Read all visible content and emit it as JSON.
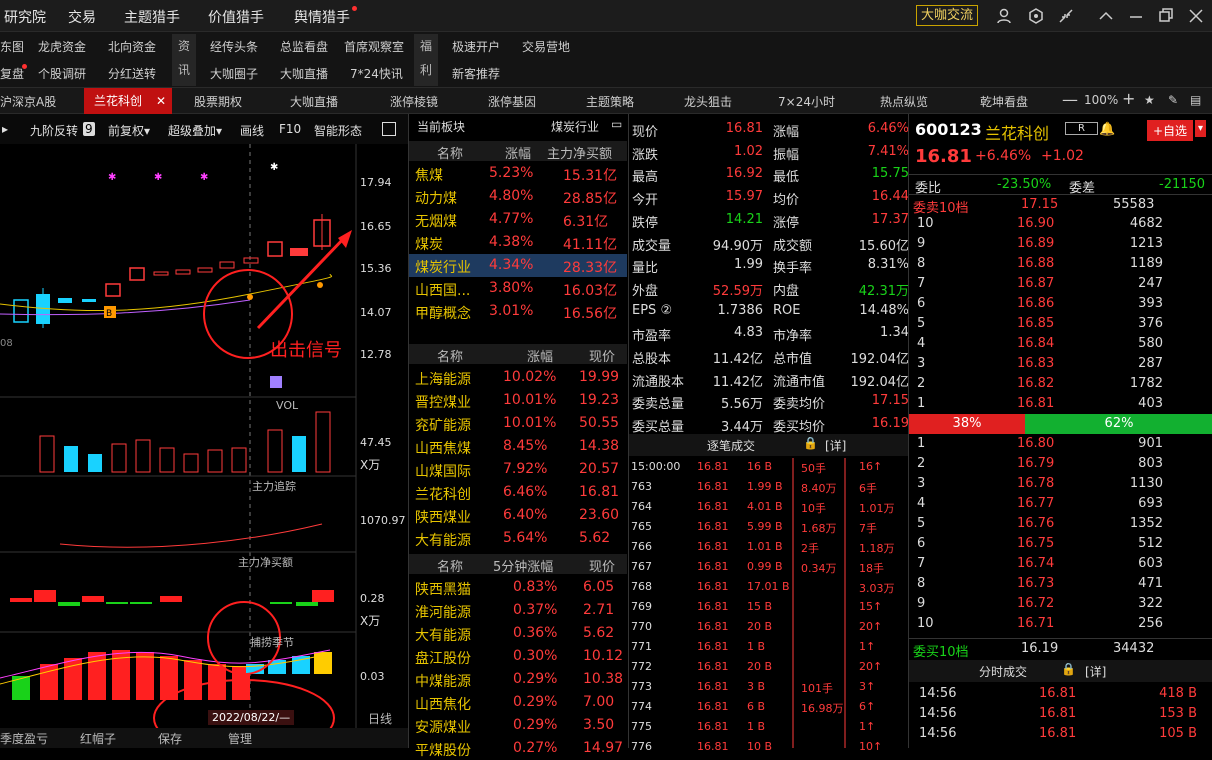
{
  "topnav": [
    "研究院",
    "交易",
    "主题猎手",
    "价值猎手",
    "舆情猎手"
  ],
  "promo": "大咖交流",
  "bar2": {
    "left1": [
      "东图",
      "龙虎资金",
      "北向资金"
    ],
    "left2": [
      "复盘",
      "个股调研",
      "分红送转"
    ],
    "v1": [
      "资",
      "讯"
    ],
    "mid1": [
      "经传头条",
      "总监看盘",
      "首席观察室"
    ],
    "mid2": [
      "大咖圈子",
      "大咖直播",
      "7*24快讯"
    ],
    "v2": [
      "福",
      "利"
    ],
    "r1": [
      "极速开户",
      "交易营地"
    ],
    "r2": [
      "新客推荐"
    ]
  },
  "tabs": [
    "沪深京A股",
    "兰花科创",
    "股票期权",
    "大咖直播",
    "涨停棱镜",
    "涨停基因",
    "主题策略",
    "龙头狙击",
    "7×24小时",
    "热点纵览",
    "乾坤看盘"
  ],
  "zoom": "100%",
  "chart_tools": [
    "九阶反转",
    "9",
    "前复权▾",
    "超级叠加▾",
    "画线",
    "F10",
    "智能形态"
  ],
  "chart": {
    "ylabels": [
      "17.94",
      "16.65",
      "15.36",
      "14.07",
      "12.78"
    ],
    "signal": "出击信号",
    "vol": "VOL",
    "vol_labels": [
      "47.45",
      "X万"
    ],
    "track": "主力追踪",
    "track_label": "1070.97",
    "net": "主力净买额",
    "net_labels": [
      "0.28",
      "X万"
    ],
    "season": "捕捞季节",
    "season_label": "0.03",
    "date": "2022/08/22/—",
    "lower_right": "日线",
    "bottom_tabs": [
      "季度盈亏",
      "红帽子",
      "保存",
      "管理"
    ],
    "b_label": "B",
    "left_tick": "08"
  },
  "sector": {
    "header": [
      "当前板块",
      "煤炭行业"
    ],
    "cols": [
      "名称",
      "涨幅",
      "主力净买额"
    ],
    "rows": [
      [
        "焦煤",
        "5.23%",
        "15.31亿"
      ],
      [
        "动力煤",
        "4.80%",
        "28.85亿"
      ],
      [
        "无烟煤",
        "4.77%",
        "6.31亿"
      ],
      [
        "煤炭",
        "4.38%",
        "41.11亿"
      ],
      [
        "煤炭行业",
        "4.34%",
        "28.33亿"
      ],
      [
        "山西国...",
        "3.80%",
        "16.03亿"
      ],
      [
        "甲醇概念",
        "3.01%",
        "16.56亿"
      ]
    ],
    "cols2": [
      "名称",
      "涨幅",
      "现价"
    ],
    "stocks": [
      [
        "上海能源",
        "10.02%",
        "19.99"
      ],
      [
        "晋控煤业",
        "10.01%",
        "19.23"
      ],
      [
        "兖矿能源",
        "10.01%",
        "50.55"
      ],
      [
        "山西焦煤",
        "8.45%",
        "14.38"
      ],
      [
        "山煤国际",
        "7.92%",
        "20.57"
      ],
      [
        "兰花科创",
        "6.46%",
        "16.81"
      ],
      [
        "陕西煤业",
        "6.40%",
        "23.60"
      ],
      [
        "大有能源",
        "5.64%",
        "5.62"
      ]
    ],
    "cols3": [
      "名称",
      "5分钟涨幅",
      "现价"
    ],
    "fast": [
      [
        "陕西黑猫",
        "0.83%",
        "6.05"
      ],
      [
        "淮河能源",
        "0.37%",
        "2.71"
      ],
      [
        "大有能源",
        "0.36%",
        "5.62"
      ],
      [
        "盘江股份",
        "0.30%",
        "10.12"
      ],
      [
        "中煤能源",
        "0.29%",
        "10.38"
      ],
      [
        "山西焦化",
        "0.29%",
        "7.00"
      ],
      [
        "安源煤业",
        "0.29%",
        "3.50"
      ],
      [
        "平煤股份",
        "0.27%",
        "14.97"
      ]
    ]
  },
  "quote": [
    [
      "现价",
      "16.81",
      "涨幅",
      "6.46%"
    ],
    [
      "涨跌",
      "1.02",
      "振幅",
      "7.41%"
    ],
    [
      "最高",
      "16.92",
      "最低",
      "15.75"
    ],
    [
      "今开",
      "15.97",
      "均价",
      "16.44"
    ],
    [
      "跌停",
      "14.21",
      "涨停",
      "17.37"
    ],
    [
      "成交量",
      "94.90万",
      "成交额",
      "15.60亿"
    ],
    [
      "量比",
      "1.99",
      "换手率",
      "8.31%"
    ],
    [
      "外盘",
      "52.59万",
      "内盘",
      "42.31万"
    ],
    [
      "EPS ②",
      "1.7386",
      "ROE",
      "14.48%"
    ],
    [
      "市盈率",
      "4.83",
      "市净率",
      "1.34"
    ],
    [
      "总股本",
      "11.42亿",
      "总市值",
      "192.04亿"
    ],
    [
      "流通股本",
      "11.42亿",
      "流通市值",
      "192.04亿"
    ],
    [
      "委卖总量",
      "5.56万",
      "委卖均价",
      "17.15"
    ],
    [
      "委买总量",
      "3.44万",
      "委买均价",
      "16.19"
    ]
  ],
  "ticks": {
    "title": "逐笔成交",
    "detail": "[详]",
    "rows": [
      [
        "15:00:00",
        "16.81",
        "16 B",
        "50手",
        "16↑"
      ],
      [
        "763",
        "16.81",
        "1.99 B",
        "8.40万",
        "6手"
      ],
      [
        "764",
        "16.81",
        "4.01 B",
        "10手",
        "1.01万"
      ],
      [
        "765",
        "16.81",
        "5.99 B",
        "1.68万",
        "7手"
      ],
      [
        "766",
        "16.81",
        "1.01 B",
        "2手",
        "1.18万"
      ],
      [
        "767",
        "16.81",
        "0.99 B",
        "0.34万",
        "18手"
      ],
      [
        "768",
        "16.81",
        "17.01 B",
        "",
        "3.03万"
      ],
      [
        "769",
        "16.81",
        "15 B",
        "",
        "15↑"
      ],
      [
        "770",
        "16.81",
        "20 B",
        "",
        "20↑"
      ],
      [
        "771",
        "16.81",
        "1 B",
        "",
        "1↑"
      ],
      [
        "772",
        "16.81",
        "20 B",
        "",
        "20↑"
      ],
      [
        "773",
        "16.81",
        "3 B",
        "101手",
        "3↑"
      ],
      [
        "774",
        "16.81",
        "6 B",
        "16.98万",
        "6↑"
      ],
      [
        "775",
        "16.81",
        "1 B",
        "",
        "1↑"
      ],
      [
        "776",
        "16.81",
        "10 B",
        "",
        "10↑"
      ]
    ]
  },
  "book": {
    "code": "600123",
    "name": "兰花科创",
    "tag": "R",
    "add": "+自选",
    "price": "16.81",
    "pct": "+6.46%",
    "chg": "+1.02",
    "wb_label": "委比",
    "wb": "-23.50%",
    "wc_label": "委差",
    "wc": "-21150",
    "ask10_label": "委卖10档",
    "ask10_price": "17.15",
    "ask10_vol": "55583",
    "asks": [
      [
        "10",
        "16.90",
        "4682"
      ],
      [
        "9",
        "16.89",
        "1213"
      ],
      [
        "8",
        "16.88",
        "1189"
      ],
      [
        "7",
        "16.87",
        "247"
      ],
      [
        "6",
        "16.86",
        "393"
      ],
      [
        "5",
        "16.85",
        "376"
      ],
      [
        "4",
        "16.84",
        "580"
      ],
      [
        "3",
        "16.83",
        "287"
      ],
      [
        "2",
        "16.82",
        "1782"
      ],
      [
        "1",
        "16.81",
        "403"
      ]
    ],
    "ratio_sell": "38%",
    "ratio_buy": "62%",
    "bids": [
      [
        "1",
        "16.80",
        "901"
      ],
      [
        "2",
        "16.79",
        "803"
      ],
      [
        "3",
        "16.78",
        "1130"
      ],
      [
        "4",
        "16.77",
        "693"
      ],
      [
        "5",
        "16.76",
        "1352"
      ],
      [
        "6",
        "16.75",
        "512"
      ],
      [
        "7",
        "16.74",
        "603"
      ],
      [
        "8",
        "16.73",
        "471"
      ],
      [
        "9",
        "16.72",
        "322"
      ],
      [
        "10",
        "16.71",
        "256"
      ]
    ],
    "bid10_label": "委买10档",
    "bid10_price": "16.19",
    "bid10_vol": "34432",
    "intraday_title": "分时成交",
    "intraday_detail": "[详]",
    "intraday": [
      [
        "14:56",
        "16.81",
        "418 B"
      ],
      [
        "14:56",
        "16.81",
        "153 B"
      ],
      [
        "14:56",
        "16.81",
        "105 B"
      ]
    ]
  }
}
